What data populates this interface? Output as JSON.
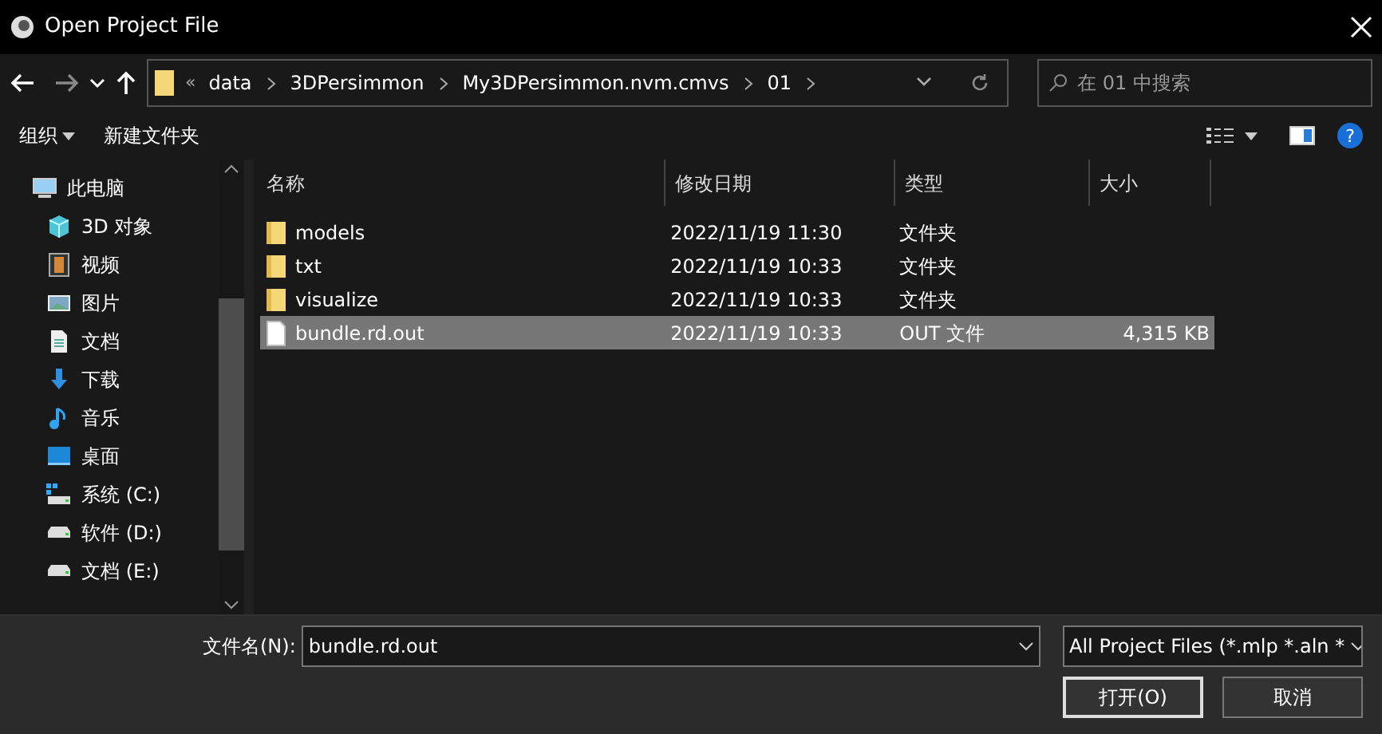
{
  "window": {
    "title": "Open Project File"
  },
  "address": {
    "overflow": "«",
    "crumbs": [
      "data",
      "3DPersimmon",
      "My3DPersimmon.nvm.cmvs",
      "01"
    ]
  },
  "search": {
    "placeholder": "在 01 中搜索"
  },
  "toolbar": {
    "organize": "组织",
    "new_folder": "新建文件夹",
    "help": "?"
  },
  "sidebar": {
    "items": [
      {
        "label": "此电脑",
        "kind": "pc",
        "children": [
          {
            "label": "3D 对象",
            "kind": "cube"
          },
          {
            "label": "视频",
            "kind": "video"
          },
          {
            "label": "图片",
            "kind": "picture"
          },
          {
            "label": "文档",
            "kind": "document"
          },
          {
            "label": "下载",
            "kind": "download"
          },
          {
            "label": "音乐",
            "kind": "music"
          },
          {
            "label": "桌面",
            "kind": "desktop"
          },
          {
            "label": "系统 (C:)",
            "kind": "system-drive"
          },
          {
            "label": "软件 (D:)",
            "kind": "drive"
          },
          {
            "label": "文档 (E:)",
            "kind": "drive"
          }
        ]
      }
    ]
  },
  "table": {
    "columns": [
      "名称",
      "修改日期",
      "类型",
      "大小"
    ],
    "rows": [
      {
        "name": "models",
        "date": "2022/11/19 11:30",
        "type": "文件夹",
        "kind": "folder",
        "selected": false
      },
      {
        "name": "txt",
        "date": "2022/11/19 10:33",
        "type": "文件夹",
        "kind": "folder",
        "selected": false
      },
      {
        "name": "visualize",
        "date": "2022/11/19 10:33",
        "type": "文件夹",
        "kind": "folder",
        "selected": false
      },
      {
        "name": "bundle.rd.out",
        "date": "2022/11/19 10:33",
        "type": "OUT 文件",
        "size": "4,315 KB",
        "kind": "file",
        "selected": true
      }
    ]
  },
  "footer": {
    "filename_label": "文件名(N):",
    "filename": "bundle.rd.out",
    "filter": "All Project Files (*.mlp *.aln *",
    "buttons": [
      "打开(O)",
      "取消"
    ]
  }
}
